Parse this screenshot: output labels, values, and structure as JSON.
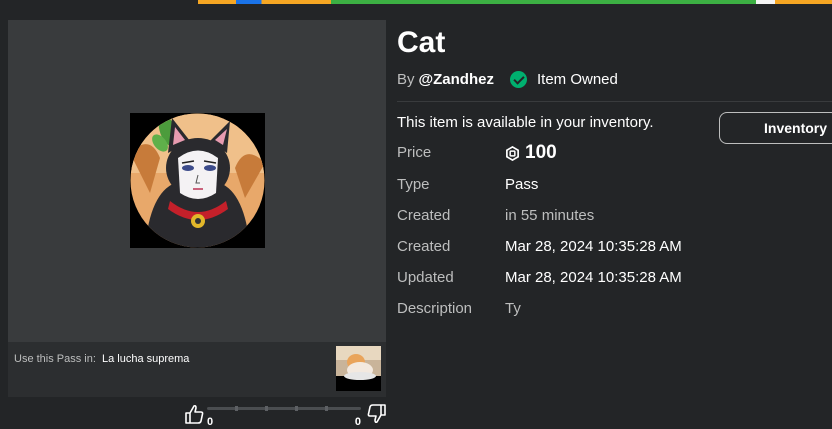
{
  "item": {
    "title": "Cat",
    "by_prefix": "By",
    "creator": "@Zandhez",
    "owned_label": "Item Owned",
    "availability": "This item is available in your inventory.",
    "inventory_button": "Inventory"
  },
  "details": [
    {
      "label": "Price",
      "value": "100"
    },
    {
      "label": "Type",
      "value": "Pass"
    },
    {
      "label": "Created",
      "value": "in 55 minutes"
    },
    {
      "label": "Created",
      "value": "Mar 28, 2024 10:35:28 AM"
    },
    {
      "label": "Updated",
      "value": "Mar 28, 2024 10:35:28 AM"
    },
    {
      "label": "Description",
      "value": "Ty"
    }
  ],
  "usage": {
    "prefix": "Use this Pass in:",
    "game": "La lucha suprema"
  },
  "votes": {
    "up": "0",
    "down": "0"
  },
  "colors": {
    "background": "#232527",
    "panel": "#393b3d",
    "owned_green": "#00b06f"
  },
  "icons": {
    "owned": "check-circle-icon",
    "currency": "robux-icon",
    "vote_up": "thumbs-up-icon",
    "vote_down": "thumbs-down-icon"
  }
}
